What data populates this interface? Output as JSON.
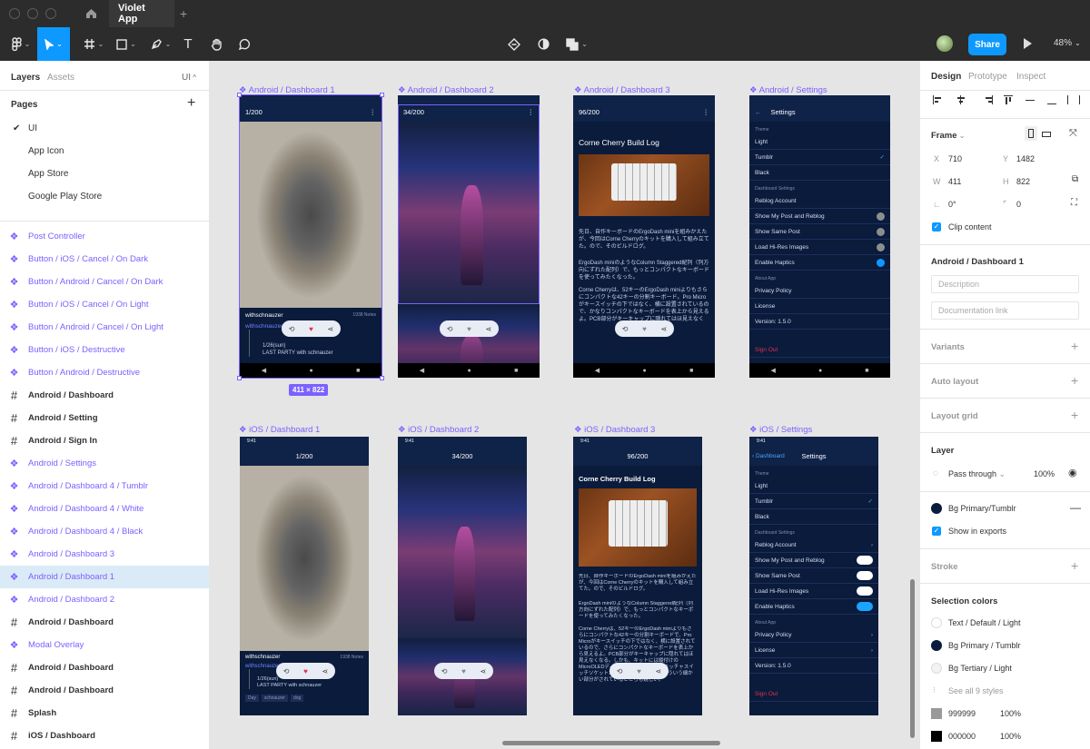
{
  "app": {
    "tab_title": "Violet App",
    "new_tab": "+",
    "home_icon": "home-icon"
  },
  "toolbar": {
    "share": "Share",
    "zoom": "48%",
    "text_tool": "T",
    "theme_icon": "contrast-icon"
  },
  "left_panel": {
    "tabs": [
      "Layers",
      "Assets"
    ],
    "page_selector": "UI",
    "pages_title": "Pages",
    "pages": [
      {
        "label": "UI",
        "selected": true
      },
      {
        "label": "App Icon",
        "selected": false
      },
      {
        "label": "App Store",
        "selected": false
      },
      {
        "label": "Google Play Store",
        "selected": false
      }
    ],
    "layers": [
      {
        "label": "Post Controller",
        "type": "component"
      },
      {
        "label": "Button / iOS / Cancel / On Dark",
        "type": "component"
      },
      {
        "label": "Button / Android / Cancel / On Dark",
        "type": "component"
      },
      {
        "label": "Button / iOS / Cancel / On Light",
        "type": "component"
      },
      {
        "label": "Button / Android / Cancel / On Light",
        "type": "component"
      },
      {
        "label": "Button / iOS / Destructive",
        "type": "component"
      },
      {
        "label": "Button / Android / Destructive",
        "type": "component"
      },
      {
        "label": "Android / Dashboard",
        "type": "frame"
      },
      {
        "label": "Android / Setting",
        "type": "frame"
      },
      {
        "label": "Android / Sign In",
        "type": "frame"
      },
      {
        "label": "Android / Settings",
        "type": "component"
      },
      {
        "label": "Android / Dashboard 4 / Tumblr",
        "type": "component"
      },
      {
        "label": "Android / Dashboard 4 / White",
        "type": "component"
      },
      {
        "label": "Android / Dashboard 4 / Black",
        "type": "component"
      },
      {
        "label": "Android / Dashboard 3",
        "type": "component"
      },
      {
        "label": "Android / Dashboard 1",
        "type": "component",
        "selected": true
      },
      {
        "label": "Android / Dashboard 2",
        "type": "component"
      },
      {
        "label": "Android / Dashboard",
        "type": "frame"
      },
      {
        "label": "Modal Overlay",
        "type": "component"
      },
      {
        "label": "Android / Dashboard",
        "type": "frame"
      },
      {
        "label": "Android / Dashboard",
        "type": "frame"
      },
      {
        "label": "Splash",
        "type": "frame"
      },
      {
        "label": "iOS / Dashboard",
        "type": "frame"
      }
    ]
  },
  "canvas": {
    "frames": [
      {
        "label": "Android / Dashboard 1"
      },
      {
        "label": "Android / Dashboard 2"
      },
      {
        "label": "Android / Dashboard 3"
      },
      {
        "label": "Android / Settings"
      },
      {
        "label": "iOS / Dashboard 1"
      },
      {
        "label": "iOS / Dashboard 2"
      },
      {
        "label": "iOS / Dashboard 3"
      },
      {
        "label": "iOS / Settings"
      }
    ],
    "selection_size": "411 × 822",
    "a1": {
      "counter": "1/200",
      "user": "withschnauzer",
      "notes": "1938 Notes",
      "reblog": "withschnauzer",
      "date": "1/26(sun)",
      "caption": "LAST PARTY with schnauzer"
    },
    "a2": {
      "counter": "34/200"
    },
    "a3": {
      "counter": "96/200",
      "title": "Corne Cherry Build Log",
      "body": "先日、自作キーボードのErgoDash miniを組みかえたが、今回はCorne Cherryのキットを購入して組み立てた。ので、そのビルドログ。",
      "body2": "ErgoDash miniのようなColumn Staggered配列（列方向にずれた配列）で、もっとコンパクトなキーボードを使ってみたくなった。",
      "body3": "Corne Cherryは、52キーのErgoDash miniよりもさらにコンパクトな42キーの分割キーボード。Pro Microがキースイッチの下ではなく、横に設置されているので、かなりコンパクトなキーボードを表上から見えるよ。PCB部分がキーキャップに隠れてはほ見えなくなるミニマムさ加減が良い。"
    },
    "a4": {
      "title": "Settings",
      "rows": [
        {
          "kind": "section",
          "label": "Theme"
        },
        {
          "kind": "row",
          "label": "Light"
        },
        {
          "kind": "row",
          "label": "Tumblr",
          "mark": "✓"
        },
        {
          "kind": "row",
          "label": "Black"
        },
        {
          "kind": "section",
          "label": "Dashboard Settings"
        },
        {
          "kind": "row",
          "label": "Reblog Account"
        },
        {
          "kind": "row",
          "label": "Show My Post and Reblog",
          "toggle": "off"
        },
        {
          "kind": "row",
          "label": "Show Same Post",
          "toggle": "off"
        },
        {
          "kind": "row",
          "label": "Load Hi-Res Images",
          "toggle": "off"
        },
        {
          "kind": "row",
          "label": "Enable Haptics",
          "toggle": "on"
        },
        {
          "kind": "section",
          "label": "About App"
        },
        {
          "kind": "row",
          "label": "Privacy Policy"
        },
        {
          "kind": "row",
          "label": "License"
        },
        {
          "kind": "row",
          "label": "Version: 1.5.0"
        },
        {
          "kind": "section",
          "label": ""
        },
        {
          "kind": "danger",
          "label": "Sign Out"
        }
      ]
    },
    "i1": {
      "time": "9:41",
      "counter": "1/200",
      "user": "withschnauzer",
      "notes": "1938 Notes",
      "reblog": "withschnauzer",
      "date": "1/26(sun)",
      "caption": "LAST PARTY with schnauzer",
      "tags": [
        "Day",
        "schnauzer",
        "dog"
      ]
    },
    "i2": {
      "time": "9:41",
      "counter": "34/200"
    },
    "i3": {
      "time": "9:41",
      "counter": "96/200",
      "title": "Corne Cherry Build Log",
      "body": "先日、自作キーボードのErgoDash miniを組みかえたが、今回はCorne Cherryのキットを購入して組み立てた。ので、そのビルドログ。",
      "body2": "ErgoDash miniのようなColumn Staggered配列（列方向にずれた配列）で、もっとコンパクトなキーボードを使ってみたくなった。",
      "body3": "Corne Cherryは、52キーのErgoDash miniよりもさらにコンパクトな42キーの分割キーボードで、Pro Microがキースイッチの下ではなく、横に設置されているので、さらにコンパクトなキーボードを表上から見えるよ。PCB部分がキーキャップに隠れてはほ見えなくなる。しかも、キットには縦付けのMicroOLEDディスプレイ、そしてオーキッチャスイッチソケットがセットになっていて、そういう細かい部分がされているところも嬉しい。"
    },
    "i4": {
      "time": "9:41",
      "back": "Dashboard",
      "title": "Settings",
      "rows": [
        {
          "kind": "section",
          "label": "Theme"
        },
        {
          "kind": "row",
          "label": "Light"
        },
        {
          "kind": "row",
          "label": "Tumblr",
          "mark": "✓"
        },
        {
          "kind": "row",
          "label": "Black"
        },
        {
          "kind": "section",
          "label": "Dashboard Settings"
        },
        {
          "kind": "row",
          "label": "Reblog Account",
          "mark": "›"
        },
        {
          "kind": "row",
          "label": "Show My Post and Reblog",
          "toggle": "off"
        },
        {
          "kind": "row",
          "label": "Show Same Post",
          "toggle": "off"
        },
        {
          "kind": "row",
          "label": "Load Hi-Res Images",
          "toggle": "off"
        },
        {
          "kind": "row",
          "label": "Enable Haptics",
          "toggle": "on"
        },
        {
          "kind": "section",
          "label": "About App"
        },
        {
          "kind": "row",
          "label": "Privacy Policy",
          "mark": "›"
        },
        {
          "kind": "row",
          "label": "License",
          "mark": "›"
        },
        {
          "kind": "row",
          "label": "Version: 1.5.0"
        },
        {
          "kind": "section",
          "label": ""
        },
        {
          "kind": "danger",
          "label": "Sign Out"
        }
      ]
    }
  },
  "right_panel": {
    "tabs": [
      "Design",
      "Prototype",
      "Inspect"
    ],
    "frame_label": "Frame",
    "x_label": "X",
    "x": "710",
    "y_label": "Y",
    "y": "1482",
    "w_label": "W",
    "w": "411",
    "h_label": "H",
    "h": "822",
    "rotation": "0°",
    "radius": "0",
    "clip_content": "Clip content",
    "component_name": "Android / Dashboard 1",
    "description_placeholder": "Description",
    "doc_link_placeholder": "Documentation link",
    "sections": {
      "variants": "Variants",
      "auto_layout": "Auto layout",
      "layout_grid": "Layout grid",
      "layer": "Layer",
      "stroke": "Stroke",
      "selection_colors": "Selection colors"
    },
    "blend": "Pass through",
    "opacity": "100%",
    "fill_style": "Bg Primary/Tumblr",
    "show_in_exports": "Show in exports",
    "selection_colors": [
      {
        "label": "Text / Default / Light",
        "color": "#ffffff"
      },
      {
        "label": "Bg Primary / Tumblr",
        "color": "#0a1b3b"
      },
      {
        "label": "Bg Tertiary / Light",
        "color": "#f3f3f3"
      }
    ],
    "see_all": "See all 9 styles",
    "hex_colors": [
      {
        "hex": "999999",
        "opacity": "100%",
        "color": "#999999"
      },
      {
        "hex": "000000",
        "opacity": "100%",
        "color": "#000000"
      }
    ]
  },
  "colors": {
    "accent": "#0d99ff",
    "component": "#7b61ff",
    "selection": "#daebf7"
  }
}
